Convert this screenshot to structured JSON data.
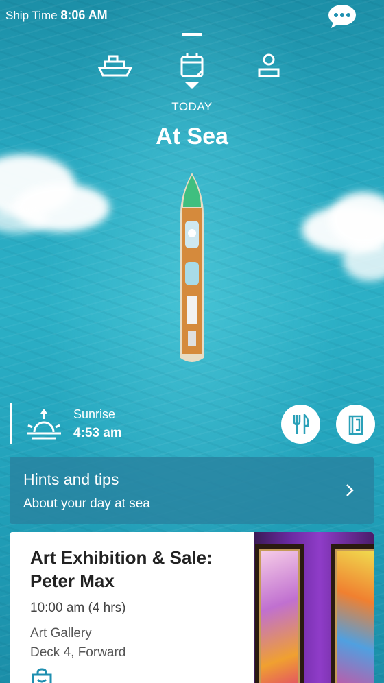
{
  "status": {
    "ship_time_label": "Ship Time",
    "time": "8:06 AM"
  },
  "nav": {
    "items": [
      {
        "name": "ship-icon"
      },
      {
        "name": "calendar-icon",
        "active": true
      },
      {
        "name": "profile-icon"
      }
    ]
  },
  "header": {
    "day": "TODAY",
    "title": "At Sea"
  },
  "sunrise": {
    "label": "Sunrise",
    "time": "4:53 am"
  },
  "quick_actions": {
    "dining_icon": "fork-knife-icon",
    "drinks_icon": "glass-icon"
  },
  "hints": {
    "title": "Hints and tips",
    "subtitle": "About your day at sea"
  },
  "event": {
    "title": "Art Exhibition & Sale: Peter Max",
    "time": "10:00 am (4 hrs)",
    "venue": "Art Gallery",
    "location": "Deck 4, Forward",
    "icon": "shopping-bag-icon"
  },
  "colors": {
    "ocean": "#2cb0c6",
    "panel": "#2882a0",
    "accent": "#1e8fb0"
  }
}
